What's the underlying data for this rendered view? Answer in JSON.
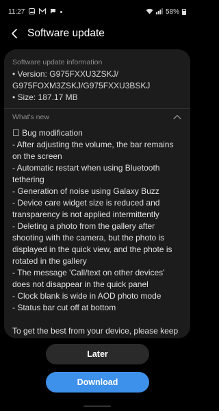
{
  "status_bar": {
    "time": "11:27",
    "left_icons": [
      "gallery-icon",
      "gmail-icon",
      "messages-icon"
    ],
    "battery": "58%"
  },
  "app_bar": {
    "title": "Software update"
  },
  "info": {
    "header": "Software update information",
    "version_line1": "• Version: G975FXXU3ZSKJ/",
    "version_line2": "G975FOXM3ZSKJ/G975FXXU3BSKJ",
    "size": "• Size: 187.17 MB"
  },
  "whats_new": {
    "header": "What's new",
    "notes": "☐ Bug modification\n - After adjusting the volume, the bar remains on the screen\n - Automatic restart when using Bluetooth tethering\n - Generation of noise using Galaxy Buzz\n - Device care widget size is reduced and transparency is not applied intermittently\n - Deleting a photo from the gallery after shooting with the camera, but the photo is displayed in the quick view, and the phote is rotated in the gallery\n - The message 'Call/text on other devices' does not disappear in the quick panel\n - Clock blank is wide in AOD photo mode\n - Status bar cut off at bottom",
    "footer": "To get the best from your device, please keep"
  },
  "buttons": {
    "later": "Later",
    "download": "Download"
  },
  "colors": {
    "background": "#000000",
    "card": "#1c1c1c",
    "accent": "#3e91ea"
  }
}
